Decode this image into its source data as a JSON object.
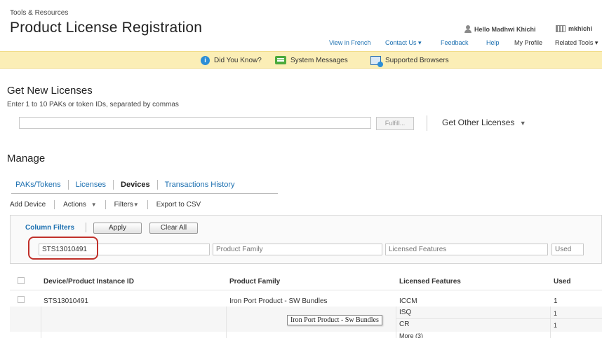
{
  "header": {
    "breadcrumb": "Tools & Resources",
    "title": "Product License Registration",
    "greeting": "Hello Madhwi Khichi",
    "username": "mkhichi"
  },
  "topnav": {
    "view_in_french": "View in French",
    "contact_us": "Contact Us",
    "feedback": "Feedback",
    "help": "Help",
    "my_profile": "My Profile",
    "related_tools": "Related Tools"
  },
  "banner": {
    "did_you_know": "Did You Know?",
    "system_messages": "System Messages",
    "supported_browsers": "Supported Browsers"
  },
  "get_new_licenses": {
    "heading": "Get New Licenses",
    "instructions": "Enter 1 to 10 PAKs or token IDs, separated by commas",
    "input_value": "",
    "fulfill_label": "Fulfill...",
    "get_other_label": "Get Other Licenses"
  },
  "manage": {
    "heading": "Manage",
    "tabs": [
      {
        "label": "PAKs/Tokens"
      },
      {
        "label": "Licenses"
      },
      {
        "label": "Devices"
      },
      {
        "label": "Transactions History"
      }
    ],
    "actions": {
      "add_device": "Add Device",
      "actions": "Actions",
      "filters": "Filters",
      "export": "Export to CSV"
    }
  },
  "filters": {
    "column_filters_label": "Column Filters",
    "apply_label": "Apply",
    "clear_all_label": "Clear All",
    "device_filter_value": "STS13010491",
    "product_family_placeholder": "Product Family",
    "licensed_features_placeholder": "Licensed Features",
    "used_placeholder": "Used"
  },
  "table": {
    "columns": [
      "Device/Product Instance ID",
      "Product Family",
      "Licensed Features",
      "Used"
    ],
    "row": {
      "device_id": "STS13010491",
      "product_family": "Iron Port Product - SW Bundles",
      "features": [
        "ICCM",
        "ISQ",
        "CR"
      ],
      "used": [
        "1",
        "1",
        "1"
      ],
      "more_link": "More (3)"
    },
    "tooltip": "Iron Port Product - Sw Bundles"
  },
  "colors": {
    "link": "#1b6fb0",
    "banner_bg": "#fbeeb6",
    "highlight_red": "#c0302a"
  }
}
